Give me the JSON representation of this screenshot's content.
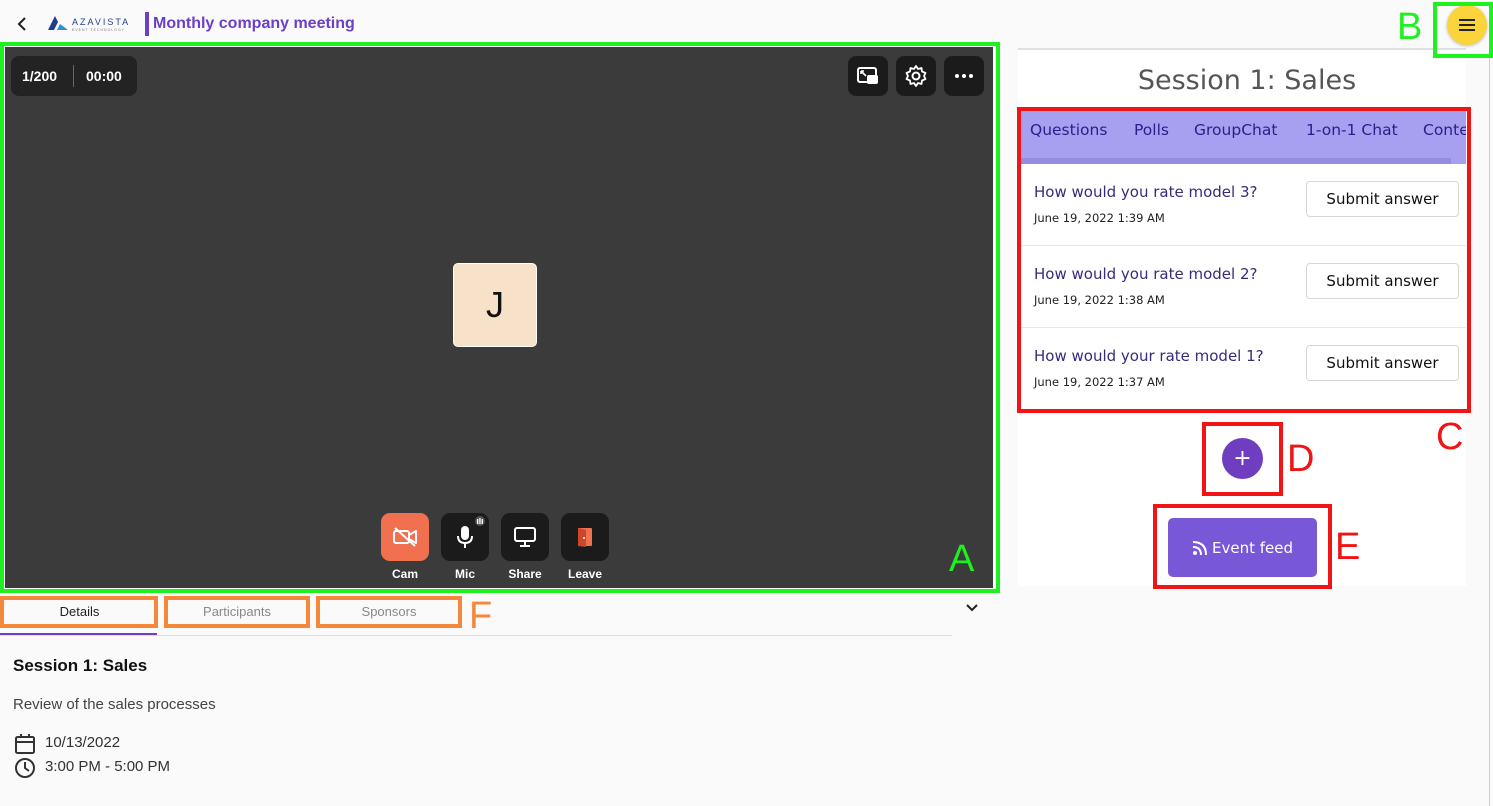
{
  "header": {
    "meeting_title": "Monthly company meeting",
    "logo_text": "AZAVISTA",
    "logo_tagline": "EVENT TECHNOLOGY"
  },
  "video": {
    "participant_count": "1/200",
    "timer": "00:00",
    "avatar_initial": "J",
    "controls": [
      {
        "label": "Cam"
      },
      {
        "label": "Mic"
      },
      {
        "label": "Share"
      },
      {
        "label": "Leave"
      }
    ]
  },
  "detail_tabs": [
    "Details",
    "Participants",
    "Sponsors"
  ],
  "session": {
    "title": "Session 1: Sales",
    "description": "Review of the sales processes",
    "date": "10/13/2022",
    "time": "3:00 PM - 5:00 PM"
  },
  "right_panel": {
    "title": "Session 1: Sales",
    "tabs": [
      "Questions",
      "Polls",
      "GroupChat",
      "1-on-1 Chat",
      "Conte"
    ],
    "questions": [
      {
        "text": "How would you rate model 3?",
        "date": "June 19, 2022 1:39 AM",
        "button": "Submit answer"
      },
      {
        "text": "How would you rate model 2?",
        "date": "June 19, 2022 1:38 AM",
        "button": "Submit answer"
      },
      {
        "text": "How would your rate model 1?",
        "date": "June 19, 2022 1:37 AM",
        "button": "Submit answer"
      }
    ],
    "add_button": "+",
    "event_feed_label": "Event feed"
  },
  "annotations": {
    "A": "A",
    "B": "B",
    "C": "C",
    "D": "D",
    "E": "E",
    "F": "F"
  },
  "colors": {
    "accent": "#6b3fc8",
    "video_bg": "#3c3b3b",
    "tab_bar": "#a79ff0",
    "menu_button": "#fbd43b",
    "event_feed": "#7858d6",
    "annotation_green": "#1ff01f",
    "annotation_red": "#f01414",
    "annotation_orange": "#f5873a"
  }
}
